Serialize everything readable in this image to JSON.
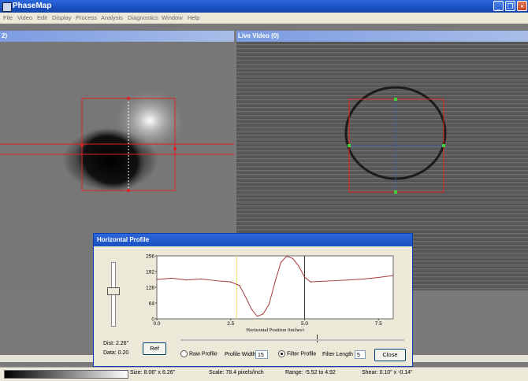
{
  "app": {
    "title": "PhaseMap"
  },
  "menu": [
    "File",
    "Video",
    "Edit",
    "Display",
    "Process",
    "Analysis",
    "Diagnostics",
    "Window",
    "Help"
  ],
  "windows": {
    "left": {
      "title": "2)"
    },
    "right": {
      "title": "Live Video (0)"
    }
  },
  "dialog": {
    "title": "Horizontal Profile",
    "dist_label": "Dist: 2.26\"",
    "data_label": "Data: 0.20",
    "ref_button": "Ref",
    "raw_profile_label": "Raw Profile",
    "profile_width_label": "Profile Width",
    "profile_width_value": "15",
    "filter_profile_label": "Filter Profile",
    "filter_length_label": "Filter Length",
    "filter_length_value": "5",
    "close_button": "Close"
  },
  "status": {
    "size": "Size: 8.06\" x 6.26\"",
    "scale": "Scale: 78.4 pixels/inch",
    "range": "Range: -5.52 to 4.92",
    "shear": "Shear: 0.10\" x -0.14\""
  },
  "chart_data": {
    "type": "line",
    "xlabel": "Horizontal Position (inches)",
    "ylabel": "",
    "xlim": [
      0,
      8.0
    ],
    "ylim": [
      0,
      256
    ],
    "x_ticks": [
      "0.0",
      "2.5",
      "5.0",
      "7.5"
    ],
    "y_ticks": [
      "0",
      "64",
      "128",
      "192",
      "256"
    ],
    "series": [
      {
        "x": [
          0,
          0.5,
          1.0,
          1.5,
          2.0,
          2.5,
          2.8,
          3.0,
          3.2,
          3.4,
          3.6,
          3.8,
          4.0,
          4.2,
          4.4,
          4.6,
          4.8,
          5.0,
          5.2,
          5.5,
          6.0,
          6.5,
          7.0,
          7.5,
          8.0
        ],
        "values": [
          160,
          165,
          158,
          162,
          155,
          150,
          135,
          90,
          40,
          10,
          20,
          60,
          150,
          230,
          255,
          245,
          215,
          170,
          150,
          152,
          155,
          158,
          162,
          168,
          176
        ]
      }
    ],
    "markers": [
      {
        "x": 2.7,
        "color": "#e8e05a"
      },
      {
        "x": 5.0,
        "color": "#333333"
      }
    ],
    "line_color": "#a63a3a"
  }
}
